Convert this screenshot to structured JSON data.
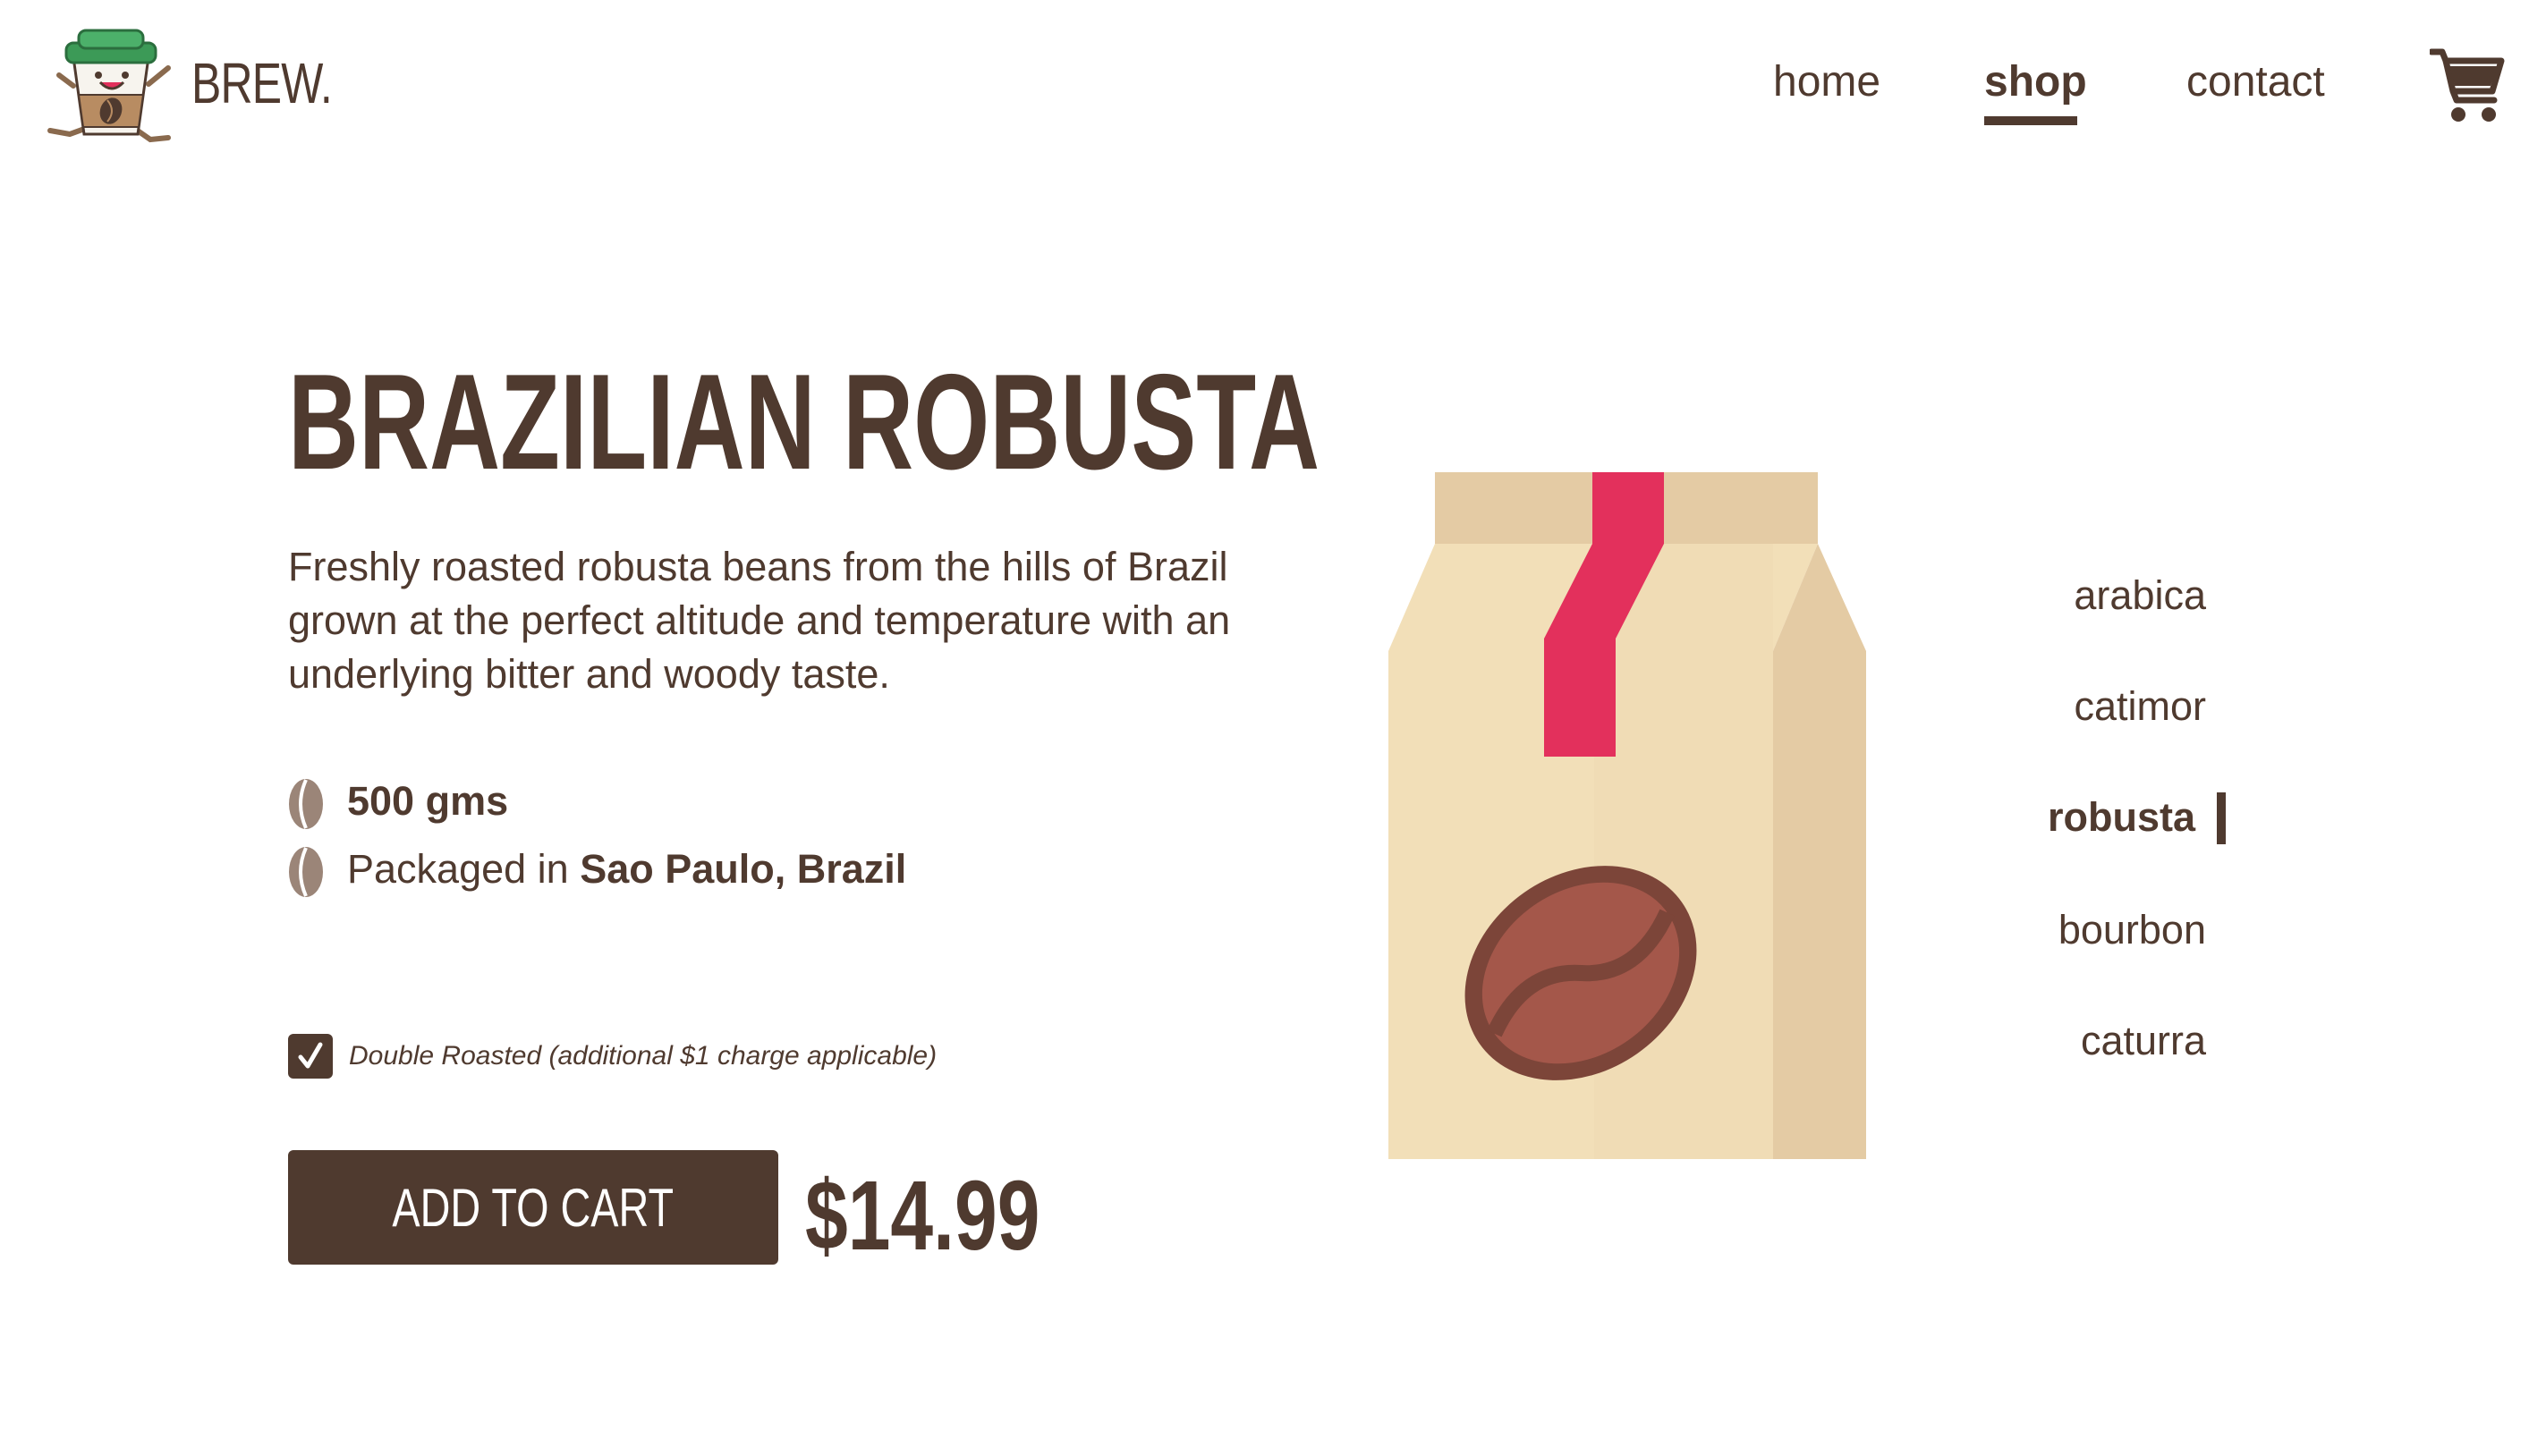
{
  "header": {
    "brand": "BREW.",
    "nav": {
      "home": "home",
      "shop": "shop",
      "contact": "contact"
    },
    "active_nav": "shop",
    "cart_icon": "shopping-cart-icon"
  },
  "product": {
    "title": "BRAZILIAN ROBUSTA",
    "description": "Freshly roasted robusta beans from the hills of Brazil grown at the perfect altitude and temperature with an underlying bitter and woody taste.",
    "weight": "500 gms",
    "packaged_prefix": "Packaged in ",
    "packaged_location": "Sao Paulo, Brazil",
    "option": {
      "label": "Double Roasted (additional $1 charge applicable)",
      "checked": true
    },
    "add_to_cart_label": "ADD TO CART",
    "price": "$14.99"
  },
  "varieties": {
    "items": [
      "arabica",
      "catimor",
      "robusta",
      "bourbon",
      "caturra"
    ],
    "selected": "robusta"
  },
  "colors": {
    "primary": "#4f3a2f",
    "bag_light": "#f2dfb8",
    "bag_dark": "#e4cba4",
    "ribbon": "#e3305c",
    "bean": "#a4574a",
    "bean_outline": "#7c4539"
  }
}
